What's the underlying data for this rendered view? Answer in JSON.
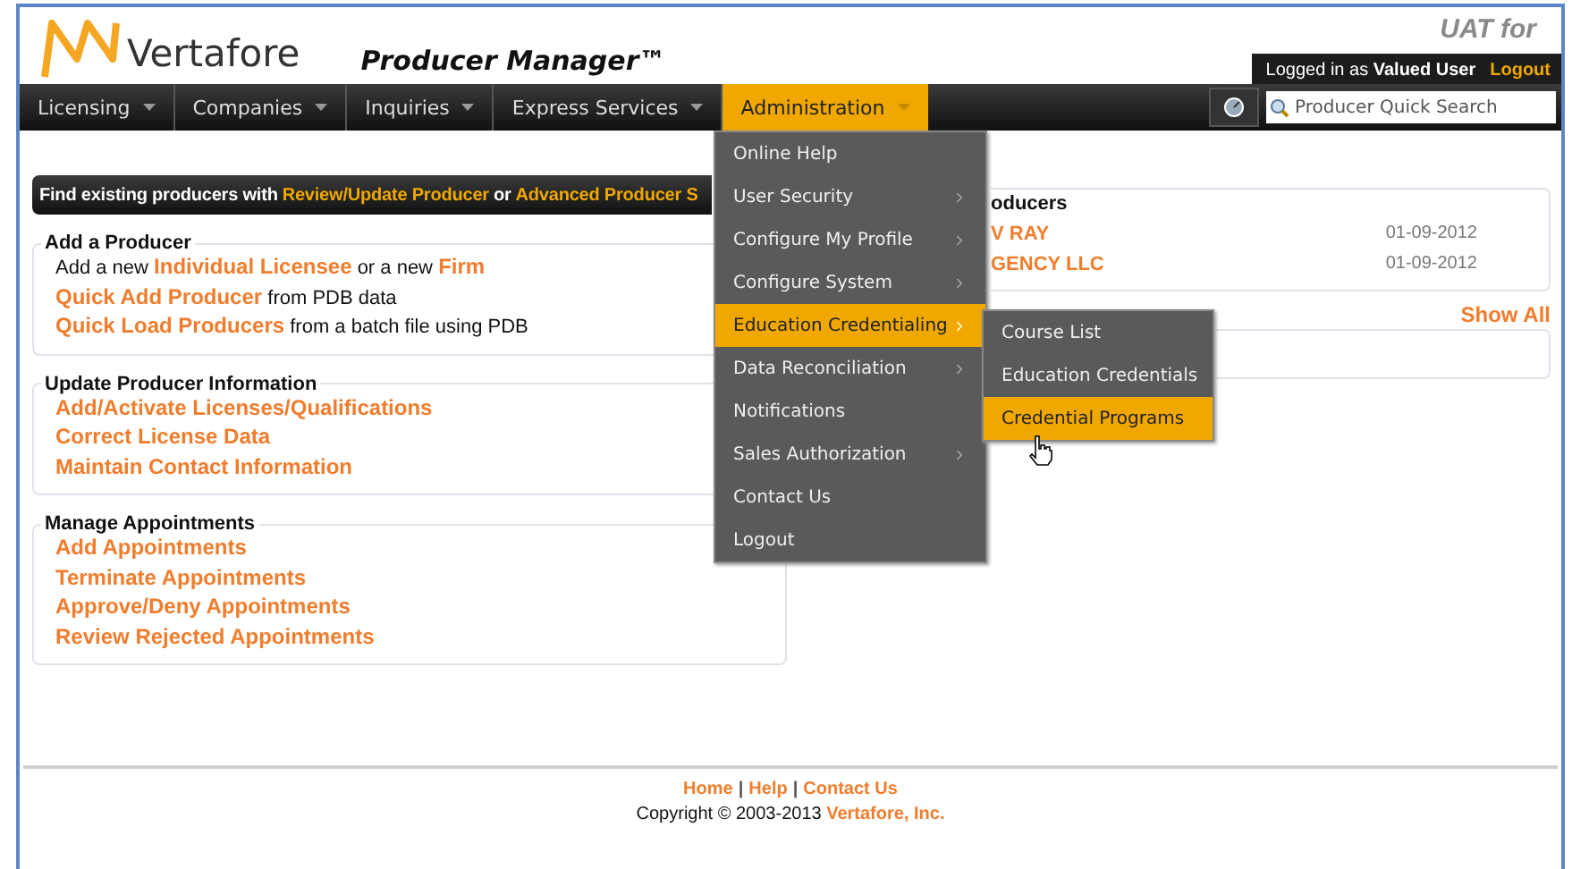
{
  "header": {
    "brand": "Vertafore",
    "product": "Producer Manager™",
    "environment": "UAT for",
    "login": {
      "prefix": "Logged in as",
      "user": "Valued User",
      "logout": "Logout"
    }
  },
  "nav": {
    "items": [
      {
        "label": "Licensing",
        "selected": false
      },
      {
        "label": "Companies",
        "selected": false
      },
      {
        "label": "Inquiries",
        "selected": false
      },
      {
        "label": "Express Services",
        "selected": false
      },
      {
        "label": "Administration",
        "selected": true
      }
    ],
    "quick_search": {
      "placeholder": "Producer Quick Search"
    }
  },
  "admin_menu": {
    "items": [
      {
        "label": "Online Help",
        "has_submenu": false,
        "selected": false
      },
      {
        "label": "User Security",
        "has_submenu": true,
        "selected": false
      },
      {
        "label": "Configure My Profile",
        "has_submenu": true,
        "selected": false
      },
      {
        "label": "Configure System",
        "has_submenu": true,
        "selected": false
      },
      {
        "label": "Education Credentialing",
        "has_submenu": true,
        "selected": true
      },
      {
        "label": "Data Reconciliation",
        "has_submenu": true,
        "selected": false
      },
      {
        "label": "Notifications",
        "has_submenu": false,
        "selected": false
      },
      {
        "label": "Sales Authorization",
        "has_submenu": true,
        "selected": false
      },
      {
        "label": "Contact Us",
        "has_submenu": false,
        "selected": false
      },
      {
        "label": "Logout",
        "has_submenu": false,
        "selected": false
      }
    ],
    "submenu": [
      {
        "label": "Course List",
        "selected": false
      },
      {
        "label": "Education Credentials",
        "selected": false
      },
      {
        "label": "Credential Programs",
        "selected": true
      }
    ]
  },
  "banner": {
    "parts": [
      {
        "text": "Find existing producers with",
        "link": false
      },
      {
        "text": "Review/Update Producer",
        "link": true
      },
      {
        "text": "or",
        "link": false
      },
      {
        "text": "Advanced Producer S",
        "link": true
      }
    ]
  },
  "sections": [
    {
      "title": "Add a Producer",
      "lines": [
        {
          "parts": [
            {
              "text": "Add a new",
              "link": false
            },
            {
              "text": "Individual Licensee",
              "link": true
            },
            {
              "text": "or a new",
              "link": false
            },
            {
              "text": "Firm",
              "link": true
            }
          ]
        },
        {
          "parts": [
            {
              "text": "Quick Add Producer",
              "link": true
            },
            {
              "text": "from PDB data",
              "link": false
            }
          ]
        },
        {
          "parts": [
            {
              "text": "Quick Load Producers",
              "link": true
            },
            {
              "text": "from a batch file using PDB",
              "link": false
            }
          ]
        }
      ]
    },
    {
      "title": "Update Producer Information",
      "lines": [
        {
          "parts": [
            {
              "text": "Add/Activate Licenses/Qualifications",
              "link": true
            }
          ]
        },
        {
          "parts": [
            {
              "text": "Correct License Data",
              "link": true
            }
          ]
        },
        {
          "parts": [
            {
              "text": "Maintain Contact Information",
              "link": true
            }
          ]
        }
      ]
    },
    {
      "title": "Manage Appointments",
      "lines": [
        {
          "parts": [
            {
              "text": "Add Appointments",
              "link": true
            }
          ]
        },
        {
          "parts": [
            {
              "text": "Terminate Appointments",
              "link": true
            }
          ]
        },
        {
          "parts": [
            {
              "text": "Approve/Deny Appointments",
              "link": true
            }
          ]
        },
        {
          "parts": [
            {
              "text": "Review Rejected Appointments",
              "link": true
            }
          ]
        }
      ]
    }
  ],
  "recent_producers": {
    "title": "oducers",
    "rows": [
      {
        "name": "V RAY",
        "date": "01-09-2012"
      },
      {
        "name": "GENCY LLC",
        "date": "01-09-2012"
      }
    ]
  },
  "show_all": "Show All",
  "footer": {
    "links": [
      "Home",
      "Help",
      "Contact Us"
    ],
    "separator": "|",
    "copyright": "Copyright © 2003-2013",
    "company": "Vertafore, Inc."
  }
}
